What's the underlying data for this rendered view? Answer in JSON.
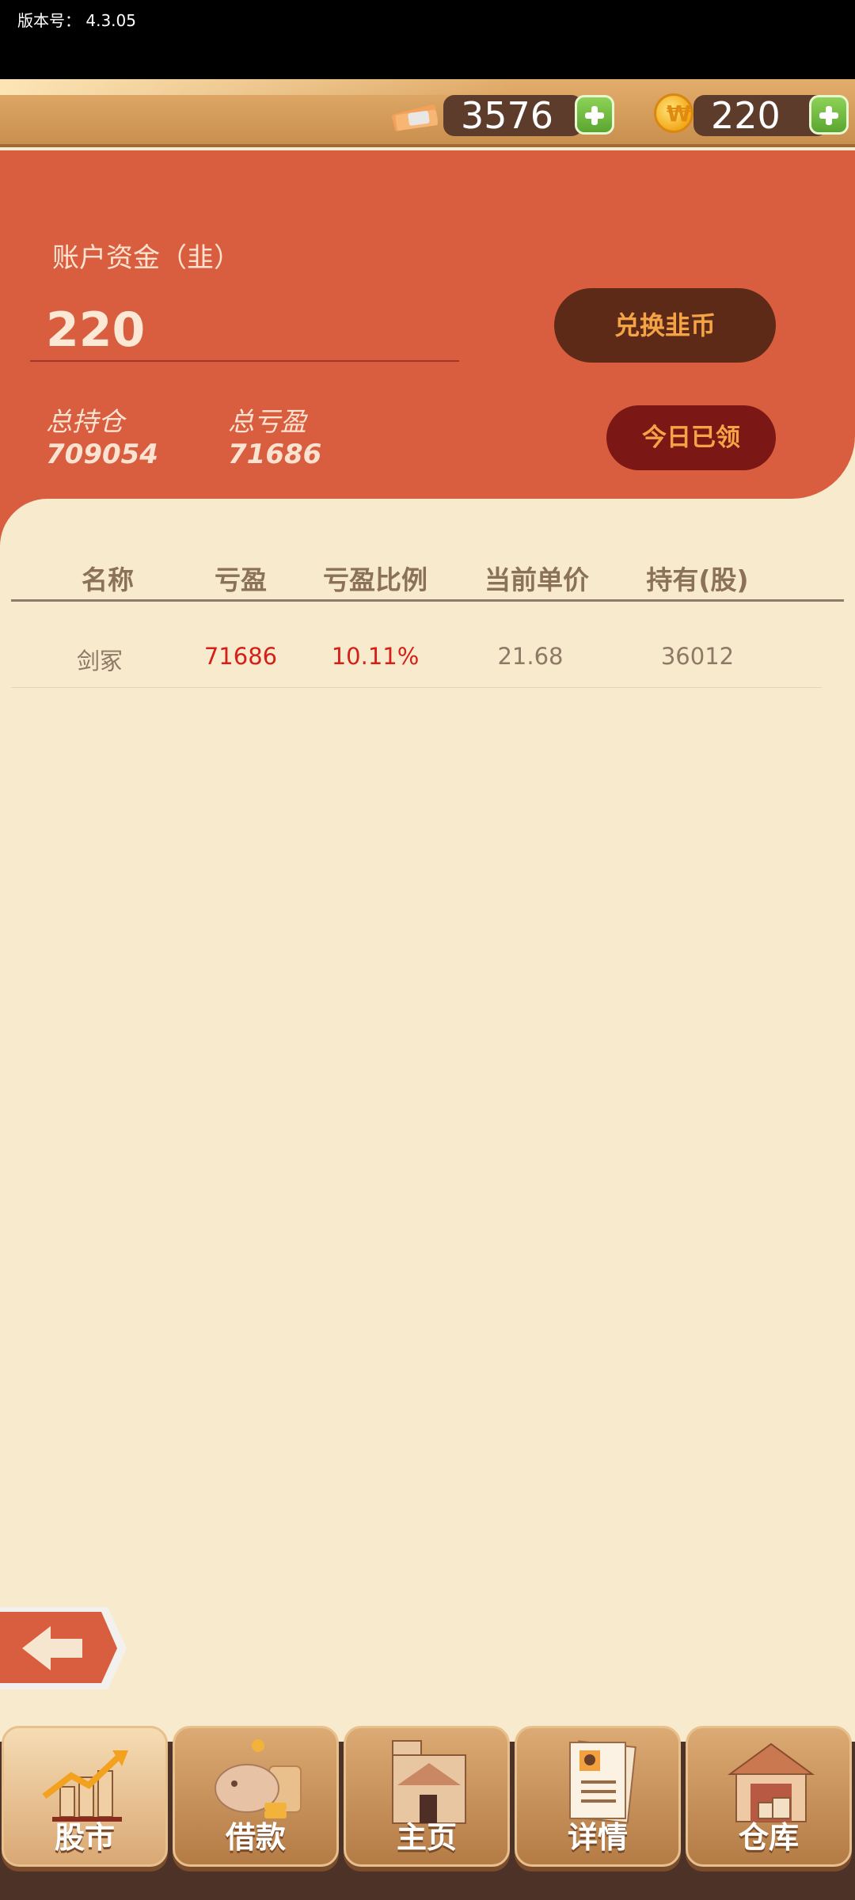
{
  "status": {
    "version": "版本号： 4.3.05"
  },
  "currency": {
    "cash": "3576",
    "coins": "220"
  },
  "account": {
    "label": "账户资金（韭）",
    "value": "220",
    "total_position_label": "总持仓",
    "total_position_value": "709054",
    "total_pnl_label": "总亏盈",
    "total_pnl_value": "71686",
    "exchange_button": "兑换韭币",
    "claimed_button": "今日已领"
  },
  "table": {
    "headers": [
      "名称",
      "亏盈",
      "亏盈比例",
      "当前单价",
      "持有(股)"
    ],
    "rows": [
      {
        "name": "剑冢",
        "pnl": "71686",
        "ratio": "10.11%",
        "price": "21.68",
        "shares": "36012"
      }
    ]
  },
  "colors": {
    "panel": "#d95e40",
    "background": "#f8eacd",
    "profit_red": "#d61f17",
    "muted": "#8a7158"
  },
  "nav": [
    {
      "label": "股市",
      "icon": "stock-chart-icon",
      "active": true
    },
    {
      "label": "借款",
      "icon": "piggy-bank-icon",
      "active": false
    },
    {
      "label": "主页",
      "icon": "house-icon",
      "active": false
    },
    {
      "label": "详情",
      "icon": "profile-document-icon",
      "active": false
    },
    {
      "label": "仓库",
      "icon": "warehouse-icon",
      "active": false
    }
  ]
}
